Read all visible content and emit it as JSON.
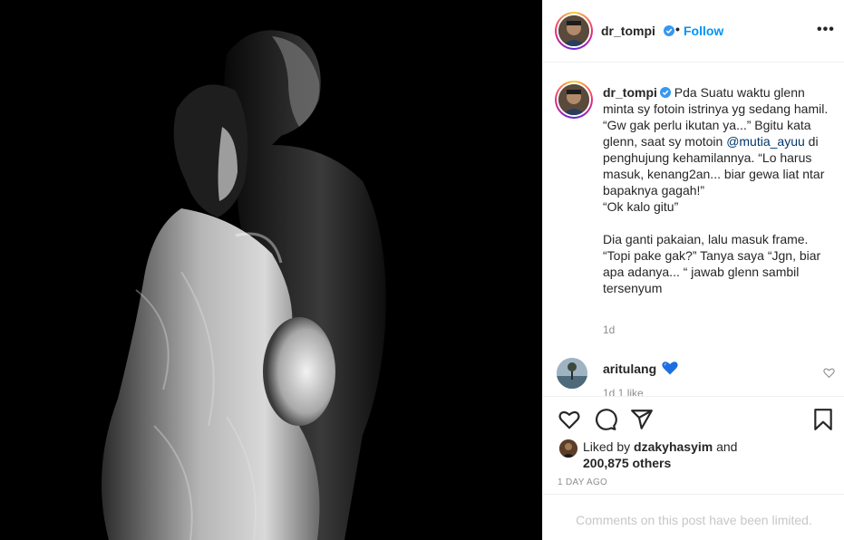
{
  "header": {
    "username": "dr_tompi",
    "separator": "•",
    "follow_label": "Follow",
    "more_label": "•••"
  },
  "caption": {
    "username": "dr_tompi",
    "text_part1": " Pda Suatu waktu glenn minta sy fotoin istrinya yg sedang hamil. “Gw gak perlu ikutan ya...” Bgitu kata glenn, saat sy motoin ",
    "mention": "@mutia_ayuu",
    "text_part2": " di penghujung kehamilannya. “Lo harus masuk, kenang2an... biar gewa liat ntar bapaknya gagah!”\n“Ok kalo gitu”\n\nDia ganti pakaian, lalu masuk frame. “Topi pake gak?” Tanya saya “Jgn, biar apa adanya... “ jawab glenn sambil tersenyum",
    "time_ago": "1d"
  },
  "comment": {
    "username": "aritulang",
    "emoji": "blue-heart-icon",
    "truncated_text": "1d   1 like"
  },
  "actions": {
    "icons": [
      "heart-icon",
      "comment-icon",
      "share-icon",
      "bookmark-icon"
    ],
    "liked_by_prefix": "Liked by ",
    "liked_by_user": "dzakyhasyim",
    "liked_by_and": " and",
    "likes_count": "200,875 others",
    "date": "1 DAY AGO"
  },
  "footer": {
    "limited_text": "Comments on this post have been limited."
  },
  "colors": {
    "link": "#0095f6",
    "mention": "#00376b",
    "muted": "#8e8e8e",
    "verified": "#3897f0"
  }
}
